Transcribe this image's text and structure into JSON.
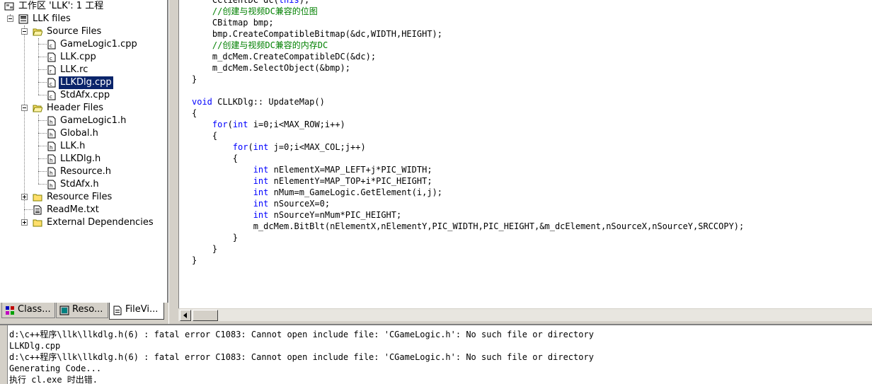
{
  "workspace": {
    "title": "工作区 'LLK': 1 工程",
    "project": "LLK files",
    "folders": {
      "source": "Source Files",
      "header": "Header Files",
      "resource": "Resource Files",
      "external": "External Dependencies"
    },
    "source_files": [
      "GameLogic1.cpp",
      "LLK.cpp",
      "LLK.rc",
      "LLKDlg.cpp",
      "StdAfx.cpp"
    ],
    "header_files": [
      "GameLogic1.h",
      "Global.h",
      "LLK.h",
      "LLKDlg.h",
      "Resource.h",
      "StdAfx.h"
    ],
    "readme": "ReadMe.txt",
    "selected_file": "LLKDlg.cpp",
    "tabs": [
      "Class...",
      "Reso...",
      "FileVi..."
    ],
    "active_tab": "FileVi..."
  },
  "editor": {
    "lines": [
      "    CClientDC dc(this);",
      "    //创建与视频DC兼容的位图",
      "    CBitmap bmp;",
      "    bmp.CreateCompatibleBitmap(&dc,WIDTH,HEIGHT);",
      "    //创建与视频DC兼容的内存DC",
      "    m_dcMem.CreateCompatibleDC(&dc);",
      "    m_dcMem.SelectObject(&bmp);",
      "}",
      "",
      "void CLLKDlg:: UpdateMap()",
      "{",
      "    for(int i=0;i<MAX_ROW;i++)",
      "    {",
      "        for(int j=0;i<MAX_COL;j++)",
      "        {",
      "            int nElementX=MAP_LEFT+j*PIC_WIDTH;",
      "            int nElementY=MAP_TOP+i*PIC_HEIGHT;",
      "            int nMum=m_GameLogic.GetElement(i,j);",
      "            int nSourceX=0;",
      "            int nSourceY=nMum*PIC_HEIGHT;",
      "            m_dcMem.BitBlt(nElementX,nElementY,PIC_WIDTH,PIC_HEIGHT,&m_dcElement,nSourceX,nSourceY,SRCCOPY);",
      "        }",
      "    }",
      "}"
    ]
  },
  "output": {
    "lines": [
      "d:\\c++程序\\llk\\llkdlg.h(6) : fatal error C1083: Cannot open include file: 'CGameLogic.h': No such file or directory",
      "LLKDlg.cpp",
      "d:\\c++程序\\llk\\llkdlg.h(6) : fatal error C1083: Cannot open include file: 'CGameLogic.h': No such file or directory",
      "Generating Code...",
      "执行 cl.exe 时出错."
    ]
  },
  "colors": {
    "keyword": "#0000ff",
    "comment": "#008000",
    "selection": "#0a246a",
    "chrome": "#d4d0c8"
  }
}
